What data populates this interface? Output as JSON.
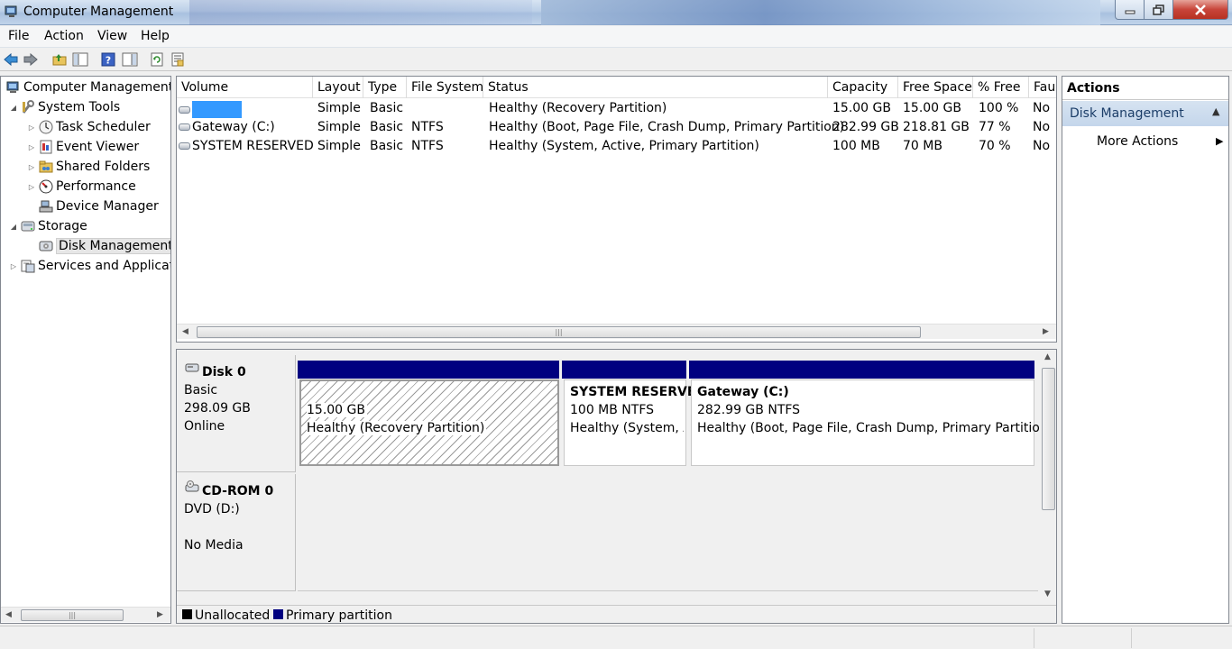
{
  "window": {
    "title": "Computer Management"
  },
  "menu": [
    "File",
    "Action",
    "View",
    "Help"
  ],
  "toolbar_icons": [
    "back-icon",
    "forward-icon",
    "up-folder-icon",
    "show-hide-tree-icon",
    "help-icon",
    "properties-icon",
    "refresh-icon",
    "export-list-icon"
  ],
  "tree": {
    "root": "Computer Management",
    "items": [
      {
        "label": "System Tools",
        "icon": "tools-icon"
      },
      {
        "label": "Task Scheduler",
        "icon": "clock-icon"
      },
      {
        "label": "Event Viewer",
        "icon": "event-viewer-icon"
      },
      {
        "label": "Shared Folders",
        "icon": "shared-folder-icon"
      },
      {
        "label": "Performance",
        "icon": "performance-icon"
      },
      {
        "label": "Device Manager",
        "icon": "device-manager-icon"
      },
      {
        "label": "Storage",
        "icon": "storage-icon"
      },
      {
        "label": "Disk Management",
        "icon": "disk-management-icon"
      },
      {
        "label": "Services and Applicat",
        "icon": "services-icon"
      }
    ]
  },
  "volumes": {
    "columns": [
      "Volume",
      "Layout",
      "Type",
      "File System",
      "Status",
      "Capacity",
      "Free Space",
      "% Free",
      "Faul"
    ],
    "rows": [
      {
        "volume": "",
        "layout": "Simple",
        "type": "Basic",
        "fs": "",
        "status": "Healthy (Recovery Partition)",
        "capacity": "15.00 GB",
        "free": "15.00 GB",
        "pct": "100 %",
        "fault": "No"
      },
      {
        "volume": "Gateway (C:)",
        "layout": "Simple",
        "type": "Basic",
        "fs": "NTFS",
        "status": "Healthy (Boot, Page File, Crash Dump, Primary Partition)",
        "capacity": "282.99 GB",
        "free": "218.81 GB",
        "pct": "77 %",
        "fault": "No"
      },
      {
        "volume": "SYSTEM RESERVED",
        "layout": "Simple",
        "type": "Basic",
        "fs": "NTFS",
        "status": "Healthy (System, Active, Primary Partition)",
        "capacity": "100 MB",
        "free": "70 MB",
        "pct": "70 %",
        "fault": "No"
      }
    ]
  },
  "disks": {
    "disk0": {
      "name": "Disk 0",
      "type": "Basic",
      "size": "298.09 GB",
      "state": "Online",
      "partitions": [
        {
          "title": "",
          "size": "15.00 GB",
          "status": "Healthy (Recovery Partition)"
        },
        {
          "title": "SYSTEM RESERVEI",
          "size": "100 MB NTFS",
          "status": "Healthy (System, A"
        },
        {
          "title": "Gateway  (C:)",
          "size": "282.99 GB NTFS",
          "status": "Healthy (Boot, Page File, Crash Dump, Primary Partition)"
        }
      ]
    },
    "cdrom0": {
      "name": "CD-ROM 0",
      "drive": "DVD (D:)",
      "state": "No Media"
    }
  },
  "legend": [
    {
      "label": "Unallocated",
      "color": "#000000"
    },
    {
      "label": "Primary partition",
      "color": "#000080"
    }
  ],
  "actions": {
    "header": "Actions",
    "section": "Disk Management",
    "more": "More Actions"
  }
}
